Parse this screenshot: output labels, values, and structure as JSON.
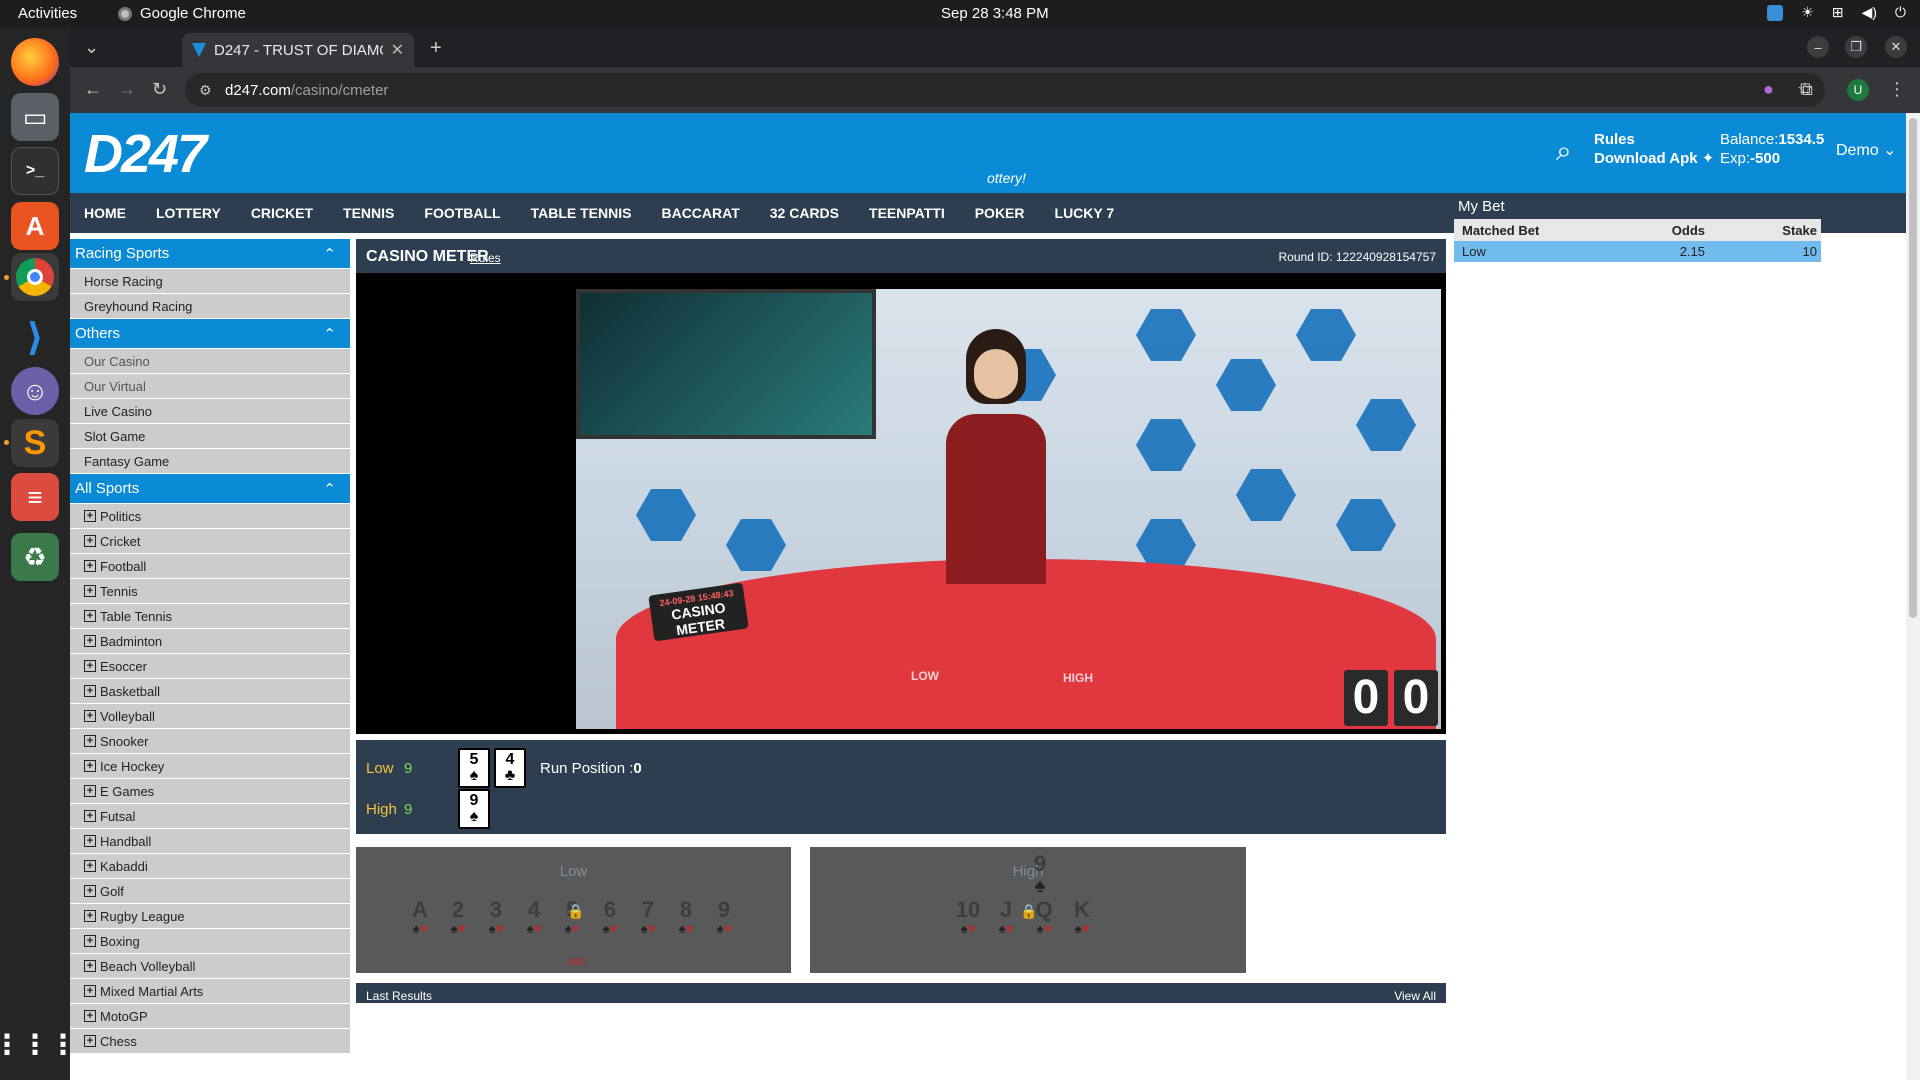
{
  "os": {
    "activities": "Activities",
    "app_name": "Google Chrome",
    "clock": "Sep 28  3:48 PM"
  },
  "dock": {
    "items": [
      "firefox-icon",
      "files-icon",
      "terminal-icon",
      "app-center-icon",
      "chrome-icon",
      "vscode-icon",
      "pidgin-icon",
      "sublime-icon",
      "todoist-icon",
      "trash-icon",
      "app-grid-icon"
    ]
  },
  "browser": {
    "tab_title": "D247 - TRUST OF DIAMO",
    "url_host": "d247.com",
    "url_path": "/casino/cmeter",
    "profile_initial": "U"
  },
  "header": {
    "logo_text": "D247",
    "marquee": "ottery!",
    "rules": "Rules",
    "download": "Download Apk",
    "balance_label": "Balance:",
    "balance_value": "1534.5",
    "exposure_label": "Exp:",
    "exposure_value": "-500",
    "user": "Demo"
  },
  "nav": [
    "HOME",
    "LOTTERY",
    "CRICKET",
    "TENNIS",
    "FOOTBALL",
    "TABLE TENNIS",
    "BACCARAT",
    "32 CARDS",
    "TEENPATTI",
    "POKER",
    "LUCKY 7"
  ],
  "sidebar": {
    "racing_title": "Racing Sports",
    "racing_items": [
      "Horse Racing",
      "Greyhound Racing"
    ],
    "others_title": "Others",
    "others_items": [
      "Our Casino",
      "Our Virtual",
      "Live Casino",
      "Slot Game",
      "Fantasy Game"
    ],
    "sports_title": "All Sports",
    "sports_items": [
      "Politics",
      "Cricket",
      "Football",
      "Tennis",
      "Table Tennis",
      "Badminton",
      "Esoccer",
      "Basketball",
      "Volleyball",
      "Snooker",
      "Ice Hockey",
      "E Games",
      "Futsal",
      "Handball",
      "Kabaddi",
      "Golf",
      "Rugby League",
      "Boxing",
      "Beach Volleyball",
      "Mixed Martial Arts",
      "MotoGP",
      "Chess"
    ]
  },
  "game": {
    "title": "CASINO METER",
    "rules": "Rules",
    "round": "Round ID: 122240928154757",
    "video_logo_date": "24-09-28 15:48:43",
    "video_logo_l1": "CASINO",
    "video_logo_l2": "METER",
    "video_low": "LOW",
    "video_high": "HIGH",
    "timer": [
      "0",
      "0"
    ],
    "low_label": "Low",
    "low_score": "9",
    "high_label": "High",
    "high_score": "9",
    "low_cards": [
      {
        "rank": "5",
        "suit": "♠"
      },
      {
        "rank": "4",
        "suit": "♣"
      }
    ],
    "high_cards": [
      {
        "rank": "9",
        "suit": "♠"
      }
    ],
    "run_label": "Run Position :",
    "run_value": "0",
    "low_box_title": "Low",
    "low_box_cards": [
      "A",
      "2",
      "3",
      "4",
      "5",
      "6",
      "7",
      "8",
      "9"
    ],
    "low_box_stake": "-500",
    "high_box_title": "High",
    "high_box_top_card": {
      "rank": "9",
      "suit": "♠"
    },
    "high_box_cards": [
      "10",
      "J",
      "Q",
      "K"
    ],
    "last_results": "Last Results",
    "view_all": "View All"
  },
  "mybet": {
    "title": "My Bet",
    "col_bet": "Matched Bet",
    "col_odds": "Odds",
    "col_stake": "Stake",
    "rows": [
      {
        "bet": "Low",
        "odds": "2.15",
        "stake": "10"
      }
    ]
  }
}
